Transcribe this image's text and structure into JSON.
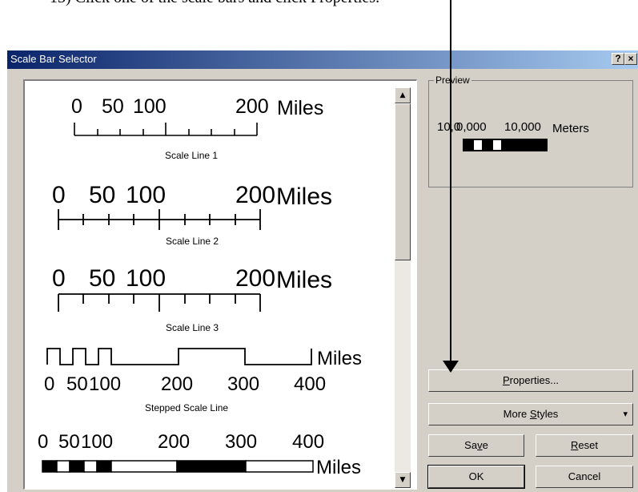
{
  "instruction": "13) Click one of the scale bars and click Properties.",
  "dialog": {
    "title": "Scale Bar Selector",
    "help_label": "?",
    "close_label": "×"
  },
  "items": [
    {
      "caption": "Scale Line 1",
      "ticks": [
        "0",
        "50",
        "100",
        "200"
      ],
      "unit": "Miles"
    },
    {
      "caption": "Scale Line 2",
      "ticks": [
        "0",
        "50",
        "100",
        "200"
      ],
      "unit": "Miles"
    },
    {
      "caption": "Scale Line 3",
      "ticks": [
        "0",
        "50",
        "100",
        "200"
      ],
      "unit": "Miles"
    },
    {
      "caption": "Stepped Scale Line",
      "ticks": [
        "0",
        "50",
        "100",
        "200",
        "300",
        "400"
      ],
      "unit": "Miles"
    },
    {
      "caption": "",
      "ticks": [
        "0",
        "50",
        "100",
        "200",
        "300",
        "400"
      ],
      "unit": "Miles"
    }
  ],
  "preview": {
    "legend": "Preview",
    "text_overlap": "10,0",
    "text_overlap2": "0,000",
    "value": "10,000",
    "unit": "Meters"
  },
  "buttons": {
    "properties": {
      "pre": "",
      "ul": "P",
      "post": "roperties..."
    },
    "more_styles": {
      "pre": "More ",
      "ul": "S",
      "post": "tyles"
    },
    "save": {
      "pre": "Sa",
      "ul": "v",
      "post": "e"
    },
    "reset": {
      "pre": "",
      "ul": "R",
      "post": "eset"
    },
    "ok": "OK",
    "cancel": "Cancel"
  },
  "scrollbar": {
    "up": "▲",
    "down": "▼"
  },
  "dropdown_arrow": "▾"
}
